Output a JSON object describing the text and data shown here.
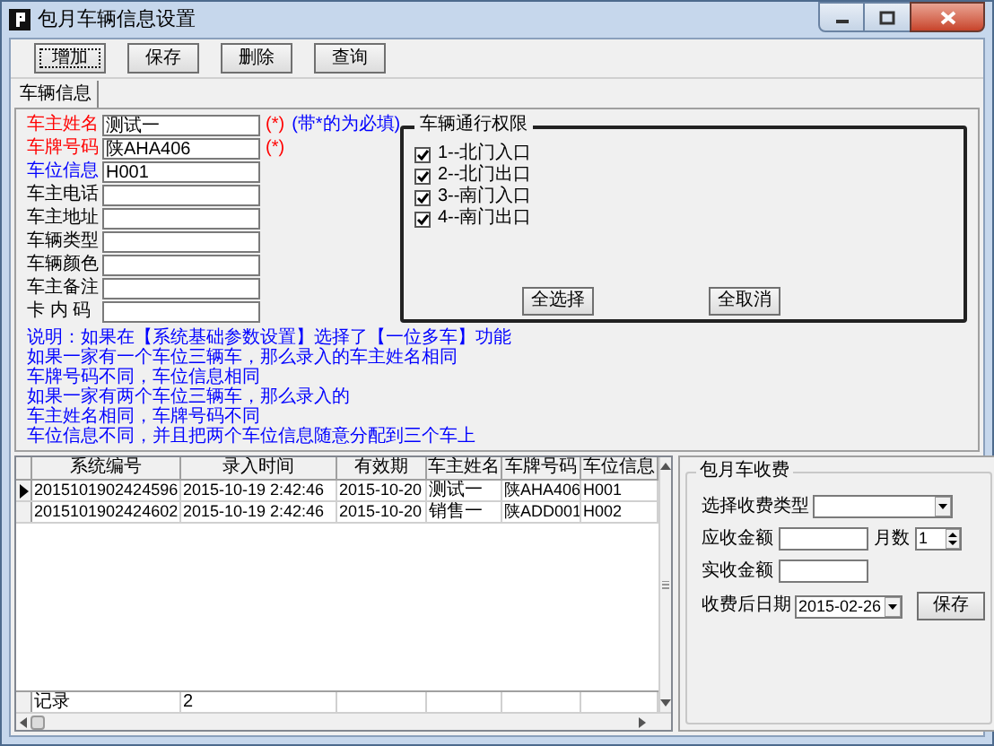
{
  "window": {
    "title": "包月车辆信息设置"
  },
  "toolbar": [
    {
      "label": "增加",
      "focused": true
    },
    {
      "label": "保存",
      "focused": false
    },
    {
      "label": "删除",
      "focused": false
    },
    {
      "label": "查询",
      "focused": false
    }
  ],
  "tabs": [
    {
      "label": "车辆信息",
      "selected": true
    }
  ],
  "form": {
    "fields": [
      {
        "label": "车主姓名",
        "color": "#ff0000",
        "value": "测试一",
        "mark": "(*)",
        "note": "(带*的为必填)"
      },
      {
        "label": "车牌号码",
        "color": "#ff0000",
        "value": "陕AHA406",
        "mark": "(*)"
      },
      {
        "label": "车位信息",
        "color": "#0000ff",
        "value": "H001"
      },
      {
        "label": "车主电话",
        "color": "#000000"
      },
      {
        "label": "车主地址",
        "color": "#000000"
      },
      {
        "label": "车辆类型",
        "color": "#000000"
      },
      {
        "label": "车辆颜色",
        "color": "#000000"
      },
      {
        "label": "车主备注",
        "color": "#000000"
      },
      {
        "label": "卡 内 码",
        "color": "#000000"
      }
    ],
    "help_text": [
      "说明：如果在【系统基础参数设置】选择了【一位多车】功能",
      "如果一家有一个车位三辆车，那么录入的车主姓名相同",
      "车牌号码不同，车位信息相同",
      "如果一家有两个车位三辆车，那么录入的",
      "车主姓名相同，车牌号码不同",
      "车位信息不同，并且把两个车位信息随意分配到三个车上"
    ]
  },
  "permissions": {
    "title": "车辆通行权限",
    "items": [
      {
        "label": "1--北门入口",
        "checked": true
      },
      {
        "label": "2--北门出口",
        "checked": true
      },
      {
        "label": "3--南门入口",
        "checked": true
      },
      {
        "label": "4--南门出口",
        "checked": true
      }
    ],
    "buttons": [
      "全选择",
      "全取消"
    ]
  },
  "grid": {
    "columns": [
      "系统编号",
      "录入时间",
      "有效期",
      "车主姓名",
      "车牌号码",
      "车位信息"
    ],
    "rows": [
      {
        "selected": true,
        "cells": [
          "2015101902424596",
          "2015-10-19 2:42:46",
          "2015-10-20",
          "测试一",
          "陕AHA406",
          "H001"
        ]
      },
      {
        "selected": false,
        "cells": [
          "2015101902424602",
          "2015-10-19 2:42:46",
          "2015-10-20",
          "销售一",
          "陕ADD001",
          "H002"
        ]
      }
    ],
    "footer": [
      "记录",
      "2"
    ]
  },
  "fee": {
    "title": "包月车收费",
    "type_label": "选择收费类型",
    "due_label": "应收金额",
    "months_label": "月数",
    "months_value": "1",
    "paid_label": "实收金额",
    "date_label": "收费后日期",
    "date_value": "2015-02-26",
    "save_button": "保存"
  }
}
